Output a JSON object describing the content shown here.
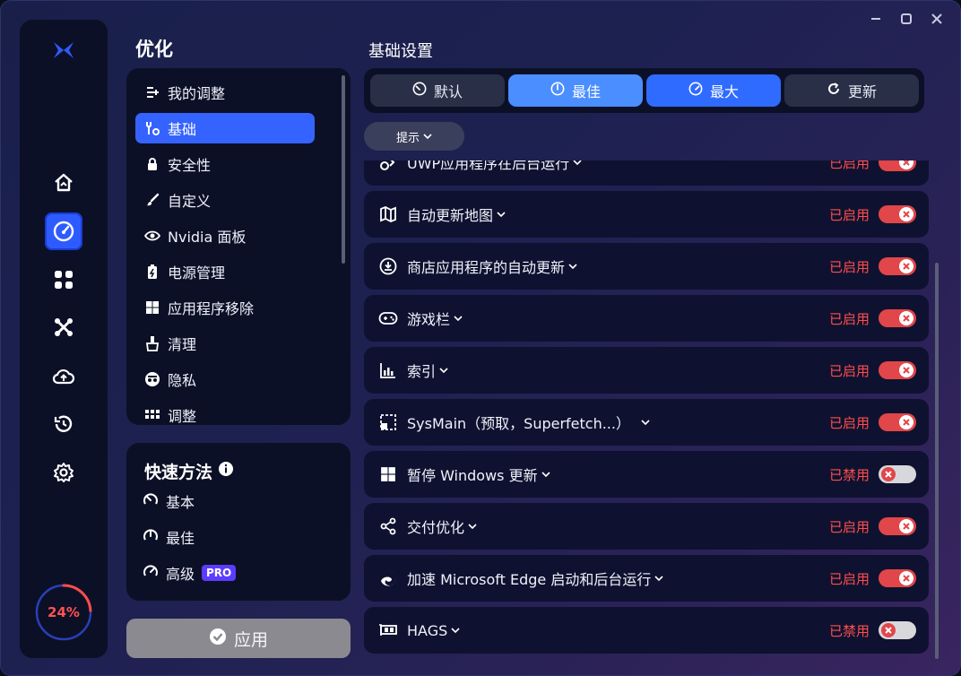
{
  "sidebar": {
    "progress_text": "24%",
    "progress_value": 0.24,
    "nav_icons": [
      "home-icon",
      "speedometer-icon",
      "apps-icon",
      "network-icon",
      "cloud-upload-icon",
      "history-icon",
      "gear-icon"
    ]
  },
  "left": {
    "title": "优化",
    "menu": [
      {
        "label": "我的调整",
        "icon": "list-add-icon"
      },
      {
        "label": "基础",
        "icon": "wrench-gear-icon"
      },
      {
        "label": "安全性",
        "icon": "lock-icon"
      },
      {
        "label": "自定义",
        "icon": "brush-icon"
      },
      {
        "label": "Nvidia 面板",
        "icon": "nvidia-eye-icon"
      },
      {
        "label": "电源管理",
        "icon": "battery-icon"
      },
      {
        "label": "应用程序移除",
        "icon": "windows-icon"
      },
      {
        "label": "清理",
        "icon": "broom-icon"
      },
      {
        "label": "隐私",
        "icon": "spy-icon"
      },
      {
        "label": "调整",
        "icon": "grid-icon"
      }
    ],
    "quick": {
      "title": "快速方法",
      "items": [
        {
          "label": "基本",
          "icon": "gauge-low-icon"
        },
        {
          "label": "最佳",
          "icon": "gauge-mid-icon"
        },
        {
          "label": "高级",
          "icon": "gauge-high-icon",
          "badge": "PRO"
        }
      ]
    },
    "apply_label": "应用"
  },
  "right": {
    "title": "基础设置",
    "presets": [
      {
        "label": "默认",
        "icon": "gauge-low-icon",
        "state": "normal"
      },
      {
        "label": "最佳",
        "icon": "gauge-mid-icon",
        "state": "light"
      },
      {
        "label": "最大",
        "icon": "gauge-high-icon",
        "state": "strong"
      },
      {
        "label": "更新",
        "icon": "refresh-icon",
        "state": "normal"
      }
    ],
    "hint_label": "提示",
    "rows": [
      {
        "label": "UWP应用程序在后台运行",
        "status": "已启用",
        "on": true,
        "icon": "apps-bg-icon"
      },
      {
        "label": "自动更新地图",
        "status": "已启用",
        "on": true,
        "icon": "map-icon"
      },
      {
        "label": "商店应用程序的自动更新",
        "status": "已启用",
        "on": true,
        "icon": "download-circle-icon"
      },
      {
        "label": "游戏栏",
        "status": "已启用",
        "on": true,
        "icon": "gamepad-icon"
      },
      {
        "label": "索引",
        "status": "已启用",
        "on": true,
        "icon": "index-bars-icon"
      },
      {
        "label": "SysMain（预取，Superfetch...）",
        "status": "已启用",
        "on": true,
        "icon": "sysmain-icon"
      },
      {
        "label": "暂停 Windows 更新",
        "status": "已禁用",
        "on": false,
        "icon": "windows-icon"
      },
      {
        "label": "交付优化",
        "status": "已启用",
        "on": true,
        "icon": "share-icon"
      },
      {
        "label": "加速 Microsoft Edge 启动和后台运行",
        "status": "已启用",
        "on": true,
        "icon": "edge-icon"
      },
      {
        "label": "HAGS",
        "status": "已禁用",
        "on": false,
        "icon": "gpu-card-icon"
      }
    ]
  },
  "colors": {
    "accent": "#3563ff",
    "enabled_toggle": "#e0464a",
    "status_text": "#ff4d4d"
  }
}
